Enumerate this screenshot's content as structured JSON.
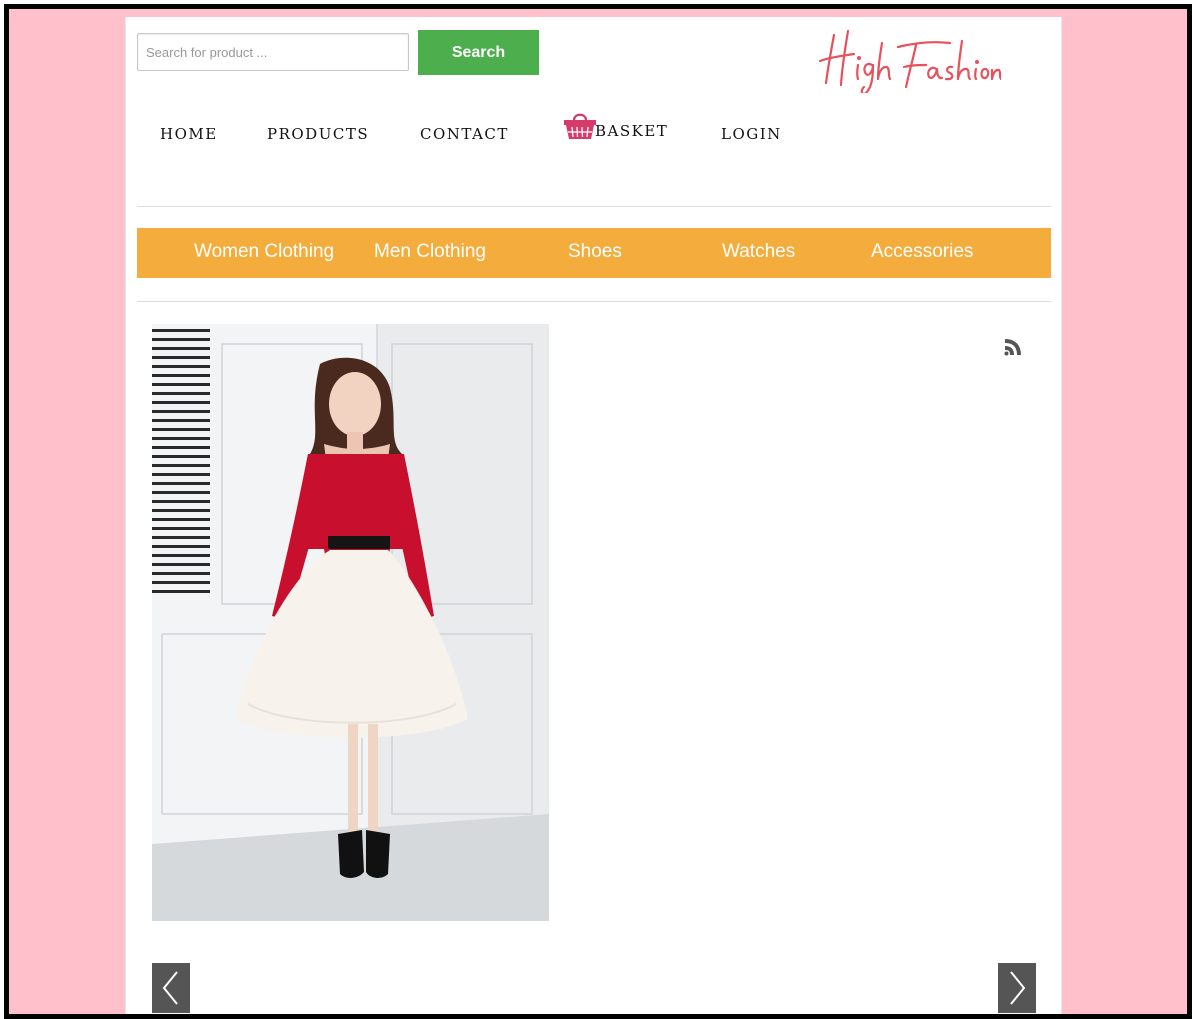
{
  "search": {
    "placeholder": "Search for product ...",
    "button_label": "Search"
  },
  "brand": {
    "name": "High Fashion",
    "color": "#e8505b"
  },
  "nav": [
    {
      "label": "HOME"
    },
    {
      "label": "PRODUCTS"
    },
    {
      "label": "CONTACT"
    },
    {
      "label": "BASKET",
      "icon": "basket-icon"
    },
    {
      "label": "LOGIN"
    }
  ],
  "categories": [
    {
      "label": "Women Clothing"
    },
    {
      "label": "Men Clothing"
    },
    {
      "label": "Shoes"
    },
    {
      "label": "Watches"
    },
    {
      "label": "Accessories"
    }
  ],
  "slider": {
    "image": "model in red lace top and white tulle skirt",
    "prev_icon": "chevron-left-icon",
    "next_icon": "chevron-right-icon"
  },
  "feed": {
    "icon": "rss-icon"
  },
  "colors": {
    "page_background": "#ffc0cb",
    "search_button": "#4cae4c",
    "category_bar": "#f4ad3d",
    "basket_icon": "#d63a6b",
    "slider_arrows": "#555555"
  }
}
